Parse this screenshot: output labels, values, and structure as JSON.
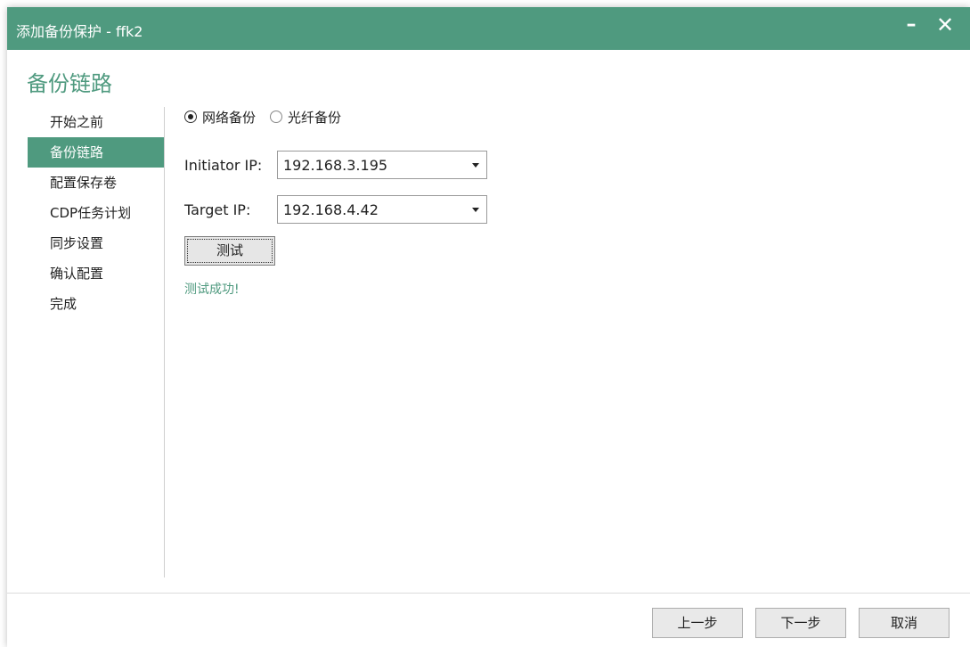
{
  "window": {
    "title": "添加备份保护 - ffk2",
    "minimize_glyph": "–",
    "close_glyph": "✕"
  },
  "page": {
    "heading": "备份链路"
  },
  "nav": {
    "items": [
      {
        "label": "开始之前"
      },
      {
        "label": "备份链路",
        "active": true
      },
      {
        "label": "配置保存卷"
      },
      {
        "label": "CDP任务计划"
      },
      {
        "label": "同步设置"
      },
      {
        "label": "确认配置"
      },
      {
        "label": "完成"
      }
    ]
  },
  "backup_type": {
    "options": [
      {
        "label": "网络备份",
        "selected": true
      },
      {
        "label": "光纤备份",
        "selected": false
      }
    ]
  },
  "initiator": {
    "label": "Initiator IP:",
    "value": "192.168.3.195"
  },
  "target": {
    "label": "Target IP:",
    "value": "192.168.4.42"
  },
  "test": {
    "button_label": "测试",
    "result_text": "测试成功!"
  },
  "footer": {
    "prev_label": "上一步",
    "next_label": "下一步",
    "cancel_label": "取消"
  },
  "colors": {
    "accent": "#4f9a7f",
    "title_text": "#ffffff"
  },
  "icons": {
    "minimize": "minimize-icon",
    "close": "close-icon",
    "dropdown": "chevron-down-icon",
    "radio": "radio-icon"
  }
}
